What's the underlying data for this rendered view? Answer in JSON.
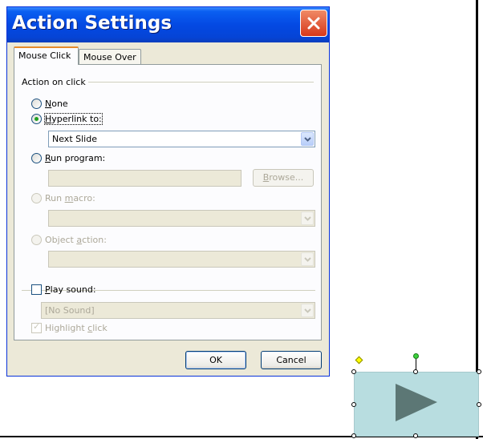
{
  "dialog": {
    "title": "Action Settings",
    "tabs": [
      {
        "label": "Mouse Click",
        "active": true
      },
      {
        "label": "Mouse Over",
        "active": false
      }
    ],
    "group_label": "Action on click",
    "options": {
      "none": {
        "prefix": "",
        "underline": "N",
        "rest": "one",
        "selected": false
      },
      "hyperlink": {
        "prefix": "",
        "underline": "H",
        "rest": "yperlink to:",
        "selected": true
      },
      "run_program": {
        "prefix": "",
        "underline": "R",
        "rest": "un program:",
        "selected": false
      },
      "run_macro": {
        "prefix": "Run ",
        "underline": "m",
        "rest": "acro:",
        "enabled": false
      },
      "object_action": {
        "prefix": "Object ",
        "underline": "a",
        "rest": "ction:",
        "enabled": false
      }
    },
    "hyperlink_value": "Next Slide",
    "program_value": "",
    "browse_label": {
      "underline": "B",
      "rest": "rowse..."
    },
    "play_sound": {
      "underline": "P",
      "rest": "lay sound:",
      "checked": false
    },
    "sound_value": "[No Sound]",
    "highlight_click": {
      "prefix": "Highlight ",
      "underline": "c",
      "rest": "lick",
      "checked": true
    },
    "ok_label": "OK",
    "cancel_label": "Cancel"
  },
  "colors": {
    "titlebar": "#0449e3",
    "close_button": "#d6381b",
    "dialog_face": "#ece9d8",
    "shape_fill": "#b8dde0",
    "arrow_fill": "#5c7775"
  },
  "icons": {
    "close": "close-icon",
    "dropdown": "chevron-down-icon",
    "play": "play-arrow-icon"
  }
}
